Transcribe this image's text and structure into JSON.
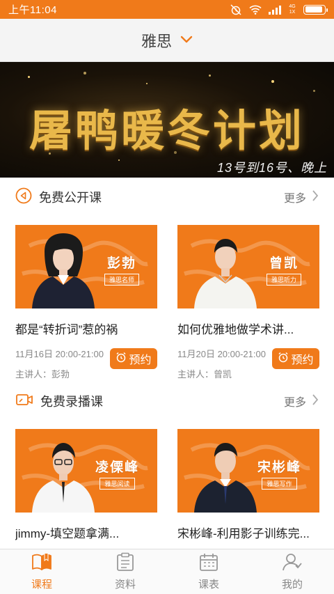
{
  "status_bar": {
    "time": "上午11:04",
    "network": "4G",
    "network_sub": "1X",
    "battery_level": 0.9,
    "icons": [
      "alarm-mute-icon",
      "wifi-icon",
      "signal-icon",
      "battery-icon"
    ]
  },
  "header": {
    "title": "雅思",
    "dropdown_icon": "chevron-down-icon"
  },
  "banner": {
    "title": "屠鸭暖冬计划",
    "subtitle": "13号到16号、晚上"
  },
  "sections": [
    {
      "title": "免费公开课",
      "icon": "play-circle-icon",
      "more_label": "更多",
      "items": [
        {
          "teacher_name": "彭勃",
          "teacher_role": "雅思名师",
          "title": "都是“转折词”惹的祸",
          "time": "11月16日 20:00-21:00",
          "host": "主讲人：彭勃",
          "button_label": "预约"
        },
        {
          "teacher_name": "曾凯",
          "teacher_role": "雅思听力",
          "title": "如何优雅地做学术讲...",
          "time": "11月20日 20:00-21:00",
          "host": "主讲人：曾凯",
          "button_label": "预约"
        }
      ]
    },
    {
      "title": "免费录播课",
      "icon": "video-camera-icon",
      "more_label": "更多",
      "items": [
        {
          "teacher_name": "凌傈峰",
          "teacher_role": "雅思阅读",
          "title": "jimmy-填空题拿满..."
        },
        {
          "teacher_name": "宋彬峰",
          "teacher_role": "雅思写作",
          "title": "宋彬峰-利用影子训练完..."
        }
      ]
    }
  ],
  "bottom_nav": [
    {
      "label": "课程",
      "icon": "book-icon",
      "active": true
    },
    {
      "label": "资料",
      "icon": "clipboard-icon",
      "active": false
    },
    {
      "label": "课表",
      "icon": "calendar-icon",
      "active": false
    },
    {
      "label": "我的",
      "icon": "user-icon",
      "active": false
    }
  ],
  "colors": {
    "accent": "#f07a1a",
    "text": "#222222",
    "muted": "#888888"
  }
}
